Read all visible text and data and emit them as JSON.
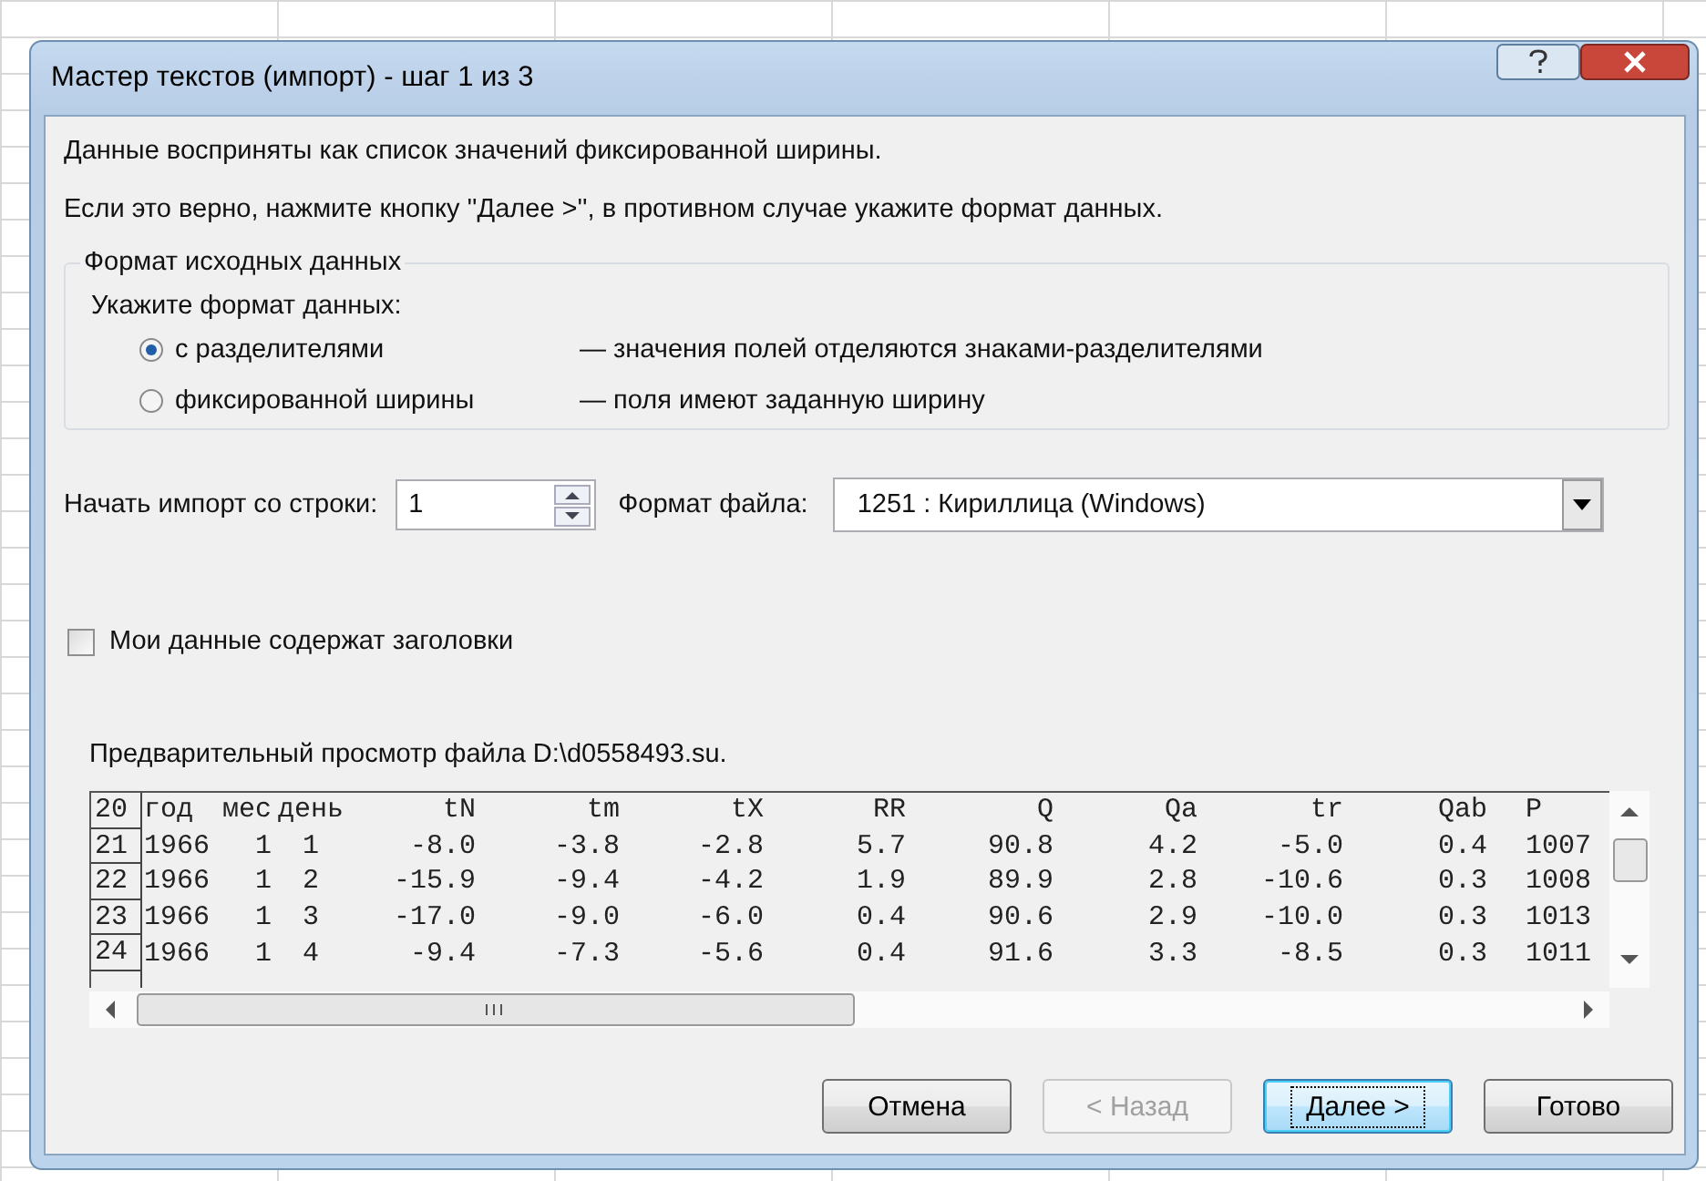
{
  "window": {
    "title": "Мастер текстов (импорт) - шаг 1 из 3"
  },
  "intro": [
    "Данные восприняты как список значений фиксированной ширины.",
    "Если это верно, нажмите кнопку ''Далее >'', в противном случае укажите формат данных."
  ],
  "group": {
    "title": "Формат исходных данных",
    "prompt": "Укажите формат данных:",
    "options": [
      {
        "label": "с разделителями",
        "description": "— значения полей отделяются знаками-разделителями",
        "selected": true
      },
      {
        "label": "фиксированной ширины",
        "description": "— поля имеют заданную ширину",
        "selected": false
      }
    ]
  },
  "start_row": {
    "label": "Начать импорт со строки:",
    "value": "1"
  },
  "file_format": {
    "label": "Формат файла:",
    "value": "1251 : Кириллица (Windows)"
  },
  "headers_checkbox": {
    "label": "Мои данные содержат заголовки",
    "checked": false
  },
  "preview": {
    "title": "Предварительный просмотр файла D:\\d0558493.su.",
    "rows": [
      {
        "number": "20",
        "cells": [
          "год",
          "мес",
          "день",
          "tN",
          "tm",
          "tX",
          "RR",
          "Q",
          "Qa",
          "tr",
          "Qab",
          "P"
        ]
      },
      {
        "number": "21",
        "cells": [
          "1966",
          "1",
          "1",
          "-8.0",
          "-3.8",
          "-2.8",
          "5.7",
          "90.8",
          "4.2",
          "-5.0",
          "0.4",
          "1007"
        ]
      },
      {
        "number": "22",
        "cells": [
          "1966",
          "1",
          "2",
          "-15.9",
          "-9.4",
          "-4.2",
          "1.9",
          "89.9",
          "2.8",
          "-10.6",
          "0.3",
          "1008"
        ]
      },
      {
        "number": "23",
        "cells": [
          "1966",
          "1",
          "3",
          "-17.0",
          "-9.0",
          "-6.0",
          "0.4",
          "90.6",
          "2.9",
          "-10.0",
          "0.3",
          "1013"
        ]
      },
      {
        "number": "24",
        "cells": [
          "1966",
          "1",
          "4",
          "-9.4",
          "-7.3",
          "-5.6",
          "0.4",
          "91.6",
          "3.3",
          "-8.5",
          "0.3",
          "1011"
        ]
      }
    ]
  },
  "buttons": [
    {
      "label": "Отмена",
      "disabled": false,
      "default": false
    },
    {
      "label": "< Назад",
      "disabled": true,
      "default": false
    },
    {
      "label": "Далее >",
      "disabled": false,
      "default": true
    },
    {
      "label": "Готово",
      "disabled": false,
      "default": false
    }
  ]
}
